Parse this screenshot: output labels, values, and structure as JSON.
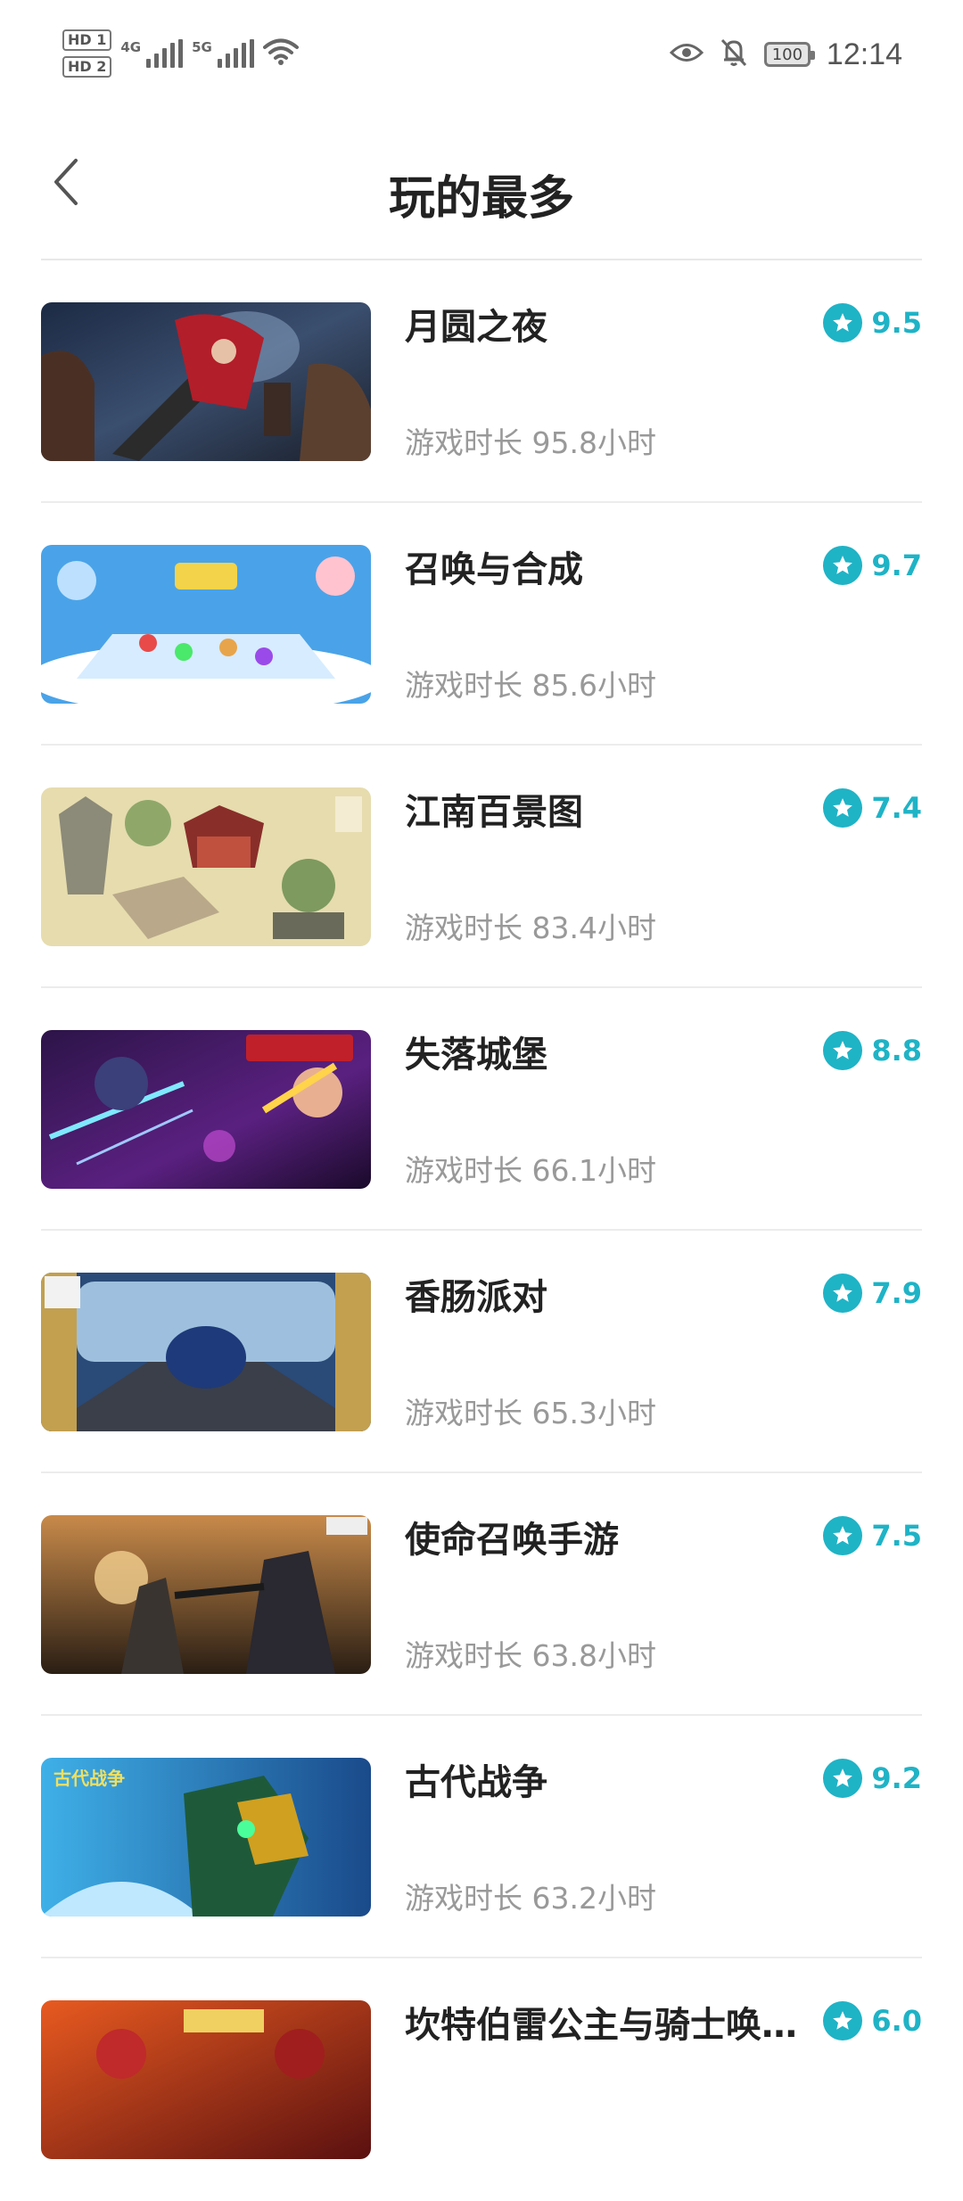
{
  "status_bar": {
    "hd1": "HD 1",
    "hd2": "HD 2",
    "net1": "4G",
    "net2": "5G",
    "battery": "100",
    "time": "12:14"
  },
  "header": {
    "title": "玩的最多"
  },
  "games": [
    {
      "name": "月圆之夜",
      "playtime": "游戏时长 95.8小时",
      "rating": "9.5"
    },
    {
      "name": "召唤与合成",
      "playtime": "游戏时长 85.6小时",
      "rating": "9.7"
    },
    {
      "name": "江南百景图",
      "playtime": "游戏时长 83.4小时",
      "rating": "7.4"
    },
    {
      "name": "失落城堡",
      "playtime": "游戏时长 66.1小时",
      "rating": "8.8"
    },
    {
      "name": "香肠派对",
      "playtime": "游戏时长 65.3小时",
      "rating": "7.9"
    },
    {
      "name": "使命召唤手游",
      "playtime": "游戏时长 63.8小时",
      "rating": "7.5"
    },
    {
      "name": "古代战争",
      "playtime": "游戏时长 63.2小时",
      "rating": "9.2"
    },
    {
      "name": "坎特伯雷公主与骑士唤…",
      "playtime": "",
      "rating": "6.0"
    }
  ],
  "colors": {
    "accent": "#1fb3c6",
    "muted": "#999999",
    "title": "#222222"
  },
  "icons": {
    "back": "chevron-left-icon",
    "rating": "star-icon",
    "eye": "eye-icon",
    "bell_off": "bell-off-icon",
    "wifi": "wifi-icon"
  }
}
